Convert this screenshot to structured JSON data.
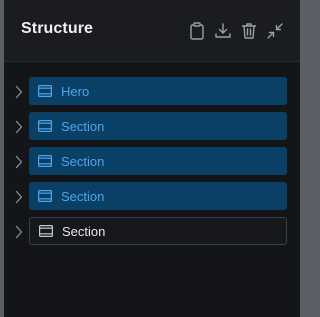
{
  "panel": {
    "title": "Structure",
    "actions": [
      {
        "name": "clipboard-icon"
      },
      {
        "name": "download-icon"
      },
      {
        "name": "trash-icon"
      },
      {
        "name": "collapse-icon"
      }
    ]
  },
  "tree": {
    "items": [
      {
        "label": "Hero",
        "selected": true,
        "icon": "layout-block-icon",
        "toggle_icon": "chevron-right-icon"
      },
      {
        "label": "Section",
        "selected": true,
        "icon": "layout-block-icon",
        "toggle_icon": "chevron-right-icon"
      },
      {
        "label": "Section",
        "selected": true,
        "icon": "layout-block-icon",
        "toggle_icon": "chevron-right-icon"
      },
      {
        "label": "Section",
        "selected": true,
        "icon": "layout-block-icon",
        "toggle_icon": "chevron-right-icon"
      },
      {
        "label": "Section",
        "selected": false,
        "icon": "layout-block-icon",
        "toggle_icon": "chevron-right-icon"
      }
    ]
  },
  "colors": {
    "panel_background": "#131519",
    "header_background": "#1a1c20",
    "selected_background": "#0a3f66",
    "selected_text": "#4ea6ea",
    "plain_text": "#e6e8eb",
    "icon_gray": "#9aa0a8"
  }
}
